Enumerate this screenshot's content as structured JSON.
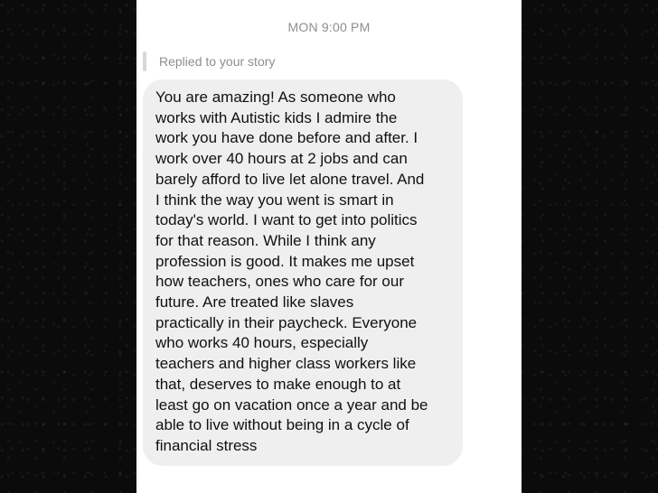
{
  "chat": {
    "timestamp": "MON 9:00 PM",
    "reply_label": "Replied to your story",
    "message": "You are amazing! As someone who\nworks with Autistic kids I admire the\nwork you have done before and after. I\nwork over 40 hours at 2 jobs and can\nbarely afford to live let alone travel. And\nI think the way you went is smart in\ntoday's world. I want to get into politics\nfor that reason. While I think any\nprofession is good. It makes me upset\nhow teachers, ones who care for our\nfuture. Are treated like slaves\npractically in their paycheck. Everyone\nwho works 40 hours, especially\nteachers and higher class workers like\nthat, deserves to make enough to at\nleast go on vacation once a year and be\nable to live without being in a cycle of\nfinancial  stress"
  }
}
